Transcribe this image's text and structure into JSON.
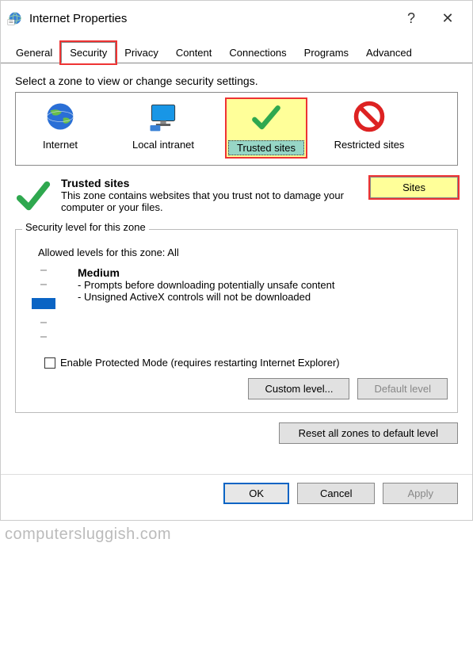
{
  "titlebar": {
    "title": "Internet Properties"
  },
  "tabs": {
    "general": "General",
    "security": "Security",
    "privacy": "Privacy",
    "content": "Content",
    "connections": "Connections",
    "programs": "Programs",
    "advanced": "Advanced"
  },
  "zone_prompt": "Select a zone to view or change security settings.",
  "zones": {
    "internet": "Internet",
    "local_intranet": "Local intranet",
    "trusted_sites": "Trusted sites",
    "restricted_sites": "Restricted sites"
  },
  "zone_desc": {
    "heading": "Trusted sites",
    "body": "This zone contains websites that you trust not to damage your computer or your files."
  },
  "sites_button": "Sites",
  "groupbox": {
    "title": "Security level for this zone",
    "allowed": "Allowed levels for this zone: All",
    "level": "Medium",
    "desc1": "- Prompts before downloading potentially unsafe content",
    "desc2": "- Unsigned ActiveX controls will not be downloaded"
  },
  "protected_mode": "Enable Protected Mode (requires restarting Internet Explorer)",
  "buttons": {
    "custom_level": "Custom level...",
    "default_level": "Default level",
    "reset_all": "Reset all zones to default level",
    "ok": "OK",
    "cancel": "Cancel",
    "apply": "Apply"
  },
  "watermark": "computersluggish.com"
}
